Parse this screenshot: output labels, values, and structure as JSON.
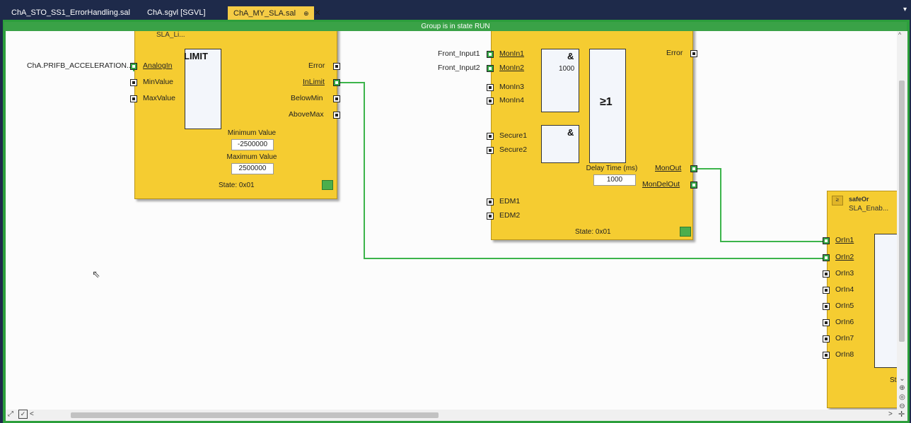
{
  "tabs": [
    {
      "label": "ChA_STO_SS1_ErrorHandling.sal",
      "active": false
    },
    {
      "label": "ChA.sgvl [SGVL]",
      "active": false
    },
    {
      "label": "ChA_MY_SLA.sal",
      "active": true
    }
  ],
  "tab_icons": {
    "pin": "pin-icon",
    "close": "close-icon",
    "menu": "dropdown-arrow-icon"
  },
  "status_bar": "Group is in state RUN",
  "blocks": {
    "limit": {
      "title": "SLA_Li...",
      "inner_label": "LIMIT",
      "external_input": "ChA.PRIFB_ACCELERATION...",
      "inputs": [
        "AnalogIn",
        "MinValue",
        "MaxValue"
      ],
      "outputs": [
        "Error",
        "InLimit",
        "BelowMin",
        "AboveMax"
      ],
      "min_label": "Minimum Value",
      "min_value": "-2500000",
      "max_label": "Maximum Value",
      "max_value": "2500000",
      "state": "State: 0x01"
    },
    "mon": {
      "external_inputs": [
        "Front_Input1",
        "Front_Input2"
      ],
      "inputs_a": [
        "MonIn1",
        "MonIn2",
        "MonIn3",
        "MonIn4"
      ],
      "inputs_b": [
        "Secure1",
        "Secure2"
      ],
      "inputs_c": [
        "EDM1",
        "EDM2"
      ],
      "and_label": "&",
      "and_label2": "&",
      "or_label": "≥1",
      "timer_value": "1000",
      "delay_label": "Delay Time (ms)",
      "delay_value": "1000",
      "outputs": [
        "Error",
        "MonOut",
        "MonDelOut"
      ],
      "state": "State: 0x01"
    },
    "safeor": {
      "title": "safeOr",
      "subtitle": "SLA_Enab...",
      "inputs": [
        "OrIn1",
        "OrIn2",
        "OrIn3",
        "OrIn4",
        "OrIn5",
        "OrIn6",
        "OrIn7",
        "OrIn8"
      ],
      "state": "St"
    }
  },
  "colors": {
    "wire": "#3cb44b",
    "block": "#f5cc31",
    "run_bar": "#3aa247"
  }
}
